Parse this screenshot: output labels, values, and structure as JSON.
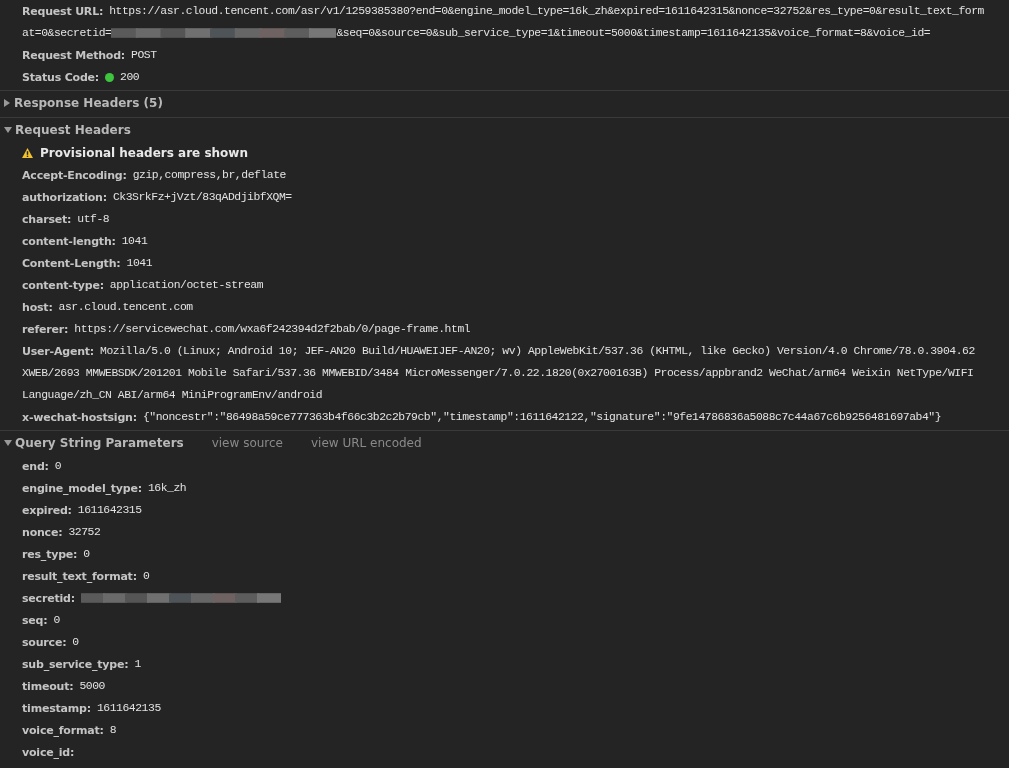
{
  "general": [
    {
      "label": "Request URL:",
      "kind": "text",
      "lines": [
        [
          {
            "kind": "text",
            "text": "https://asr.cloud.tencent.com/asr/v1/1259385380?end=0&engine_model_type=16k_zh&expired=1611642315&nonce=32752&res_type=0&result_text_form"
          }
        ],
        [
          {
            "kind": "text",
            "text": "at=0&secretid="
          },
          {
            "kind": "redacted"
          },
          {
            "kind": "text",
            "text": "&seq=0&source=0&sub_service_type=1&timeout=5000&timestamp=1611642135&voice_format=8&voice_id="
          }
        ]
      ]
    },
    {
      "label": "Request Method:",
      "kind": "text",
      "lines": [
        [
          {
            "kind": "text",
            "text": "POST"
          }
        ]
      ]
    },
    {
      "label": "Status Code:",
      "kind": "status",
      "lines": [
        [
          {
            "kind": "text",
            "text": "200"
          }
        ]
      ]
    }
  ],
  "sections": [
    {
      "title": "Response Headers (5)",
      "expanded": false
    },
    {
      "title": "Request Headers",
      "expanded": true,
      "warning": "Provisional headers are shown",
      "rows": [
        {
          "label": "Accept-Encoding:",
          "lines": [
            [
              {
                "kind": "text",
                "text": "gzip,compress,br,deflate"
              }
            ]
          ]
        },
        {
          "label": "authorization:",
          "lines": [
            [
              {
                "kind": "text",
                "text": "Ck3SrkFz+jVzt/83qADdjibfXQM="
              }
            ]
          ]
        },
        {
          "label": "charset:",
          "lines": [
            [
              {
                "kind": "text",
                "text": "utf-8"
              }
            ]
          ]
        },
        {
          "label": "content-length:",
          "lines": [
            [
              {
                "kind": "text",
                "text": "1041"
              }
            ]
          ]
        },
        {
          "label": "Content-Length:",
          "lines": [
            [
              {
                "kind": "text",
                "text": "1041"
              }
            ]
          ]
        },
        {
          "label": "content-type:",
          "lines": [
            [
              {
                "kind": "text",
                "text": "application/octet-stream"
              }
            ]
          ]
        },
        {
          "label": "host:",
          "lines": [
            [
              {
                "kind": "text",
                "text": "asr.cloud.tencent.com"
              }
            ]
          ]
        },
        {
          "label": "referer:",
          "lines": [
            [
              {
                "kind": "text",
                "text": "https://servicewechat.com/wxa6f242394d2f2bab/0/page-frame.html"
              }
            ]
          ]
        },
        {
          "label": "User-Agent:",
          "lines": [
            [
              {
                "kind": "text",
                "text": "Mozilla/5.0 (Linux; Android 10; JEF-AN20 Build/HUAWEIJEF-AN20; wv) AppleWebKit/537.36 (KHTML, like Gecko) Version/4.0 Chrome/78.0.3904.62"
              }
            ],
            [
              {
                "kind": "text",
                "text": "XWEB/2693 MMWEBSDK/201201 Mobile Safari/537.36 MMWEBID/3484 MicroMessenger/7.0.22.1820(0x2700163B) Process/appbrand2 WeChat/arm64 Weixin NetType/WIFI"
              }
            ],
            [
              {
                "kind": "text",
                "text": "Language/zh_CN ABI/arm64 MiniProgramEnv/android"
              }
            ]
          ]
        },
        {
          "label": "x-wechat-hostsign:",
          "lines": [
            [
              {
                "kind": "text",
                "text": "{\"noncestr\":\"86498a59ce777363b4f66c3b2c2b79cb\",\"timestamp\":1611642122,\"signature\":\"9fe14786836a5088c7c44a67c6b9256481697ab4\"}"
              }
            ]
          ]
        }
      ]
    },
    {
      "title": "Query String Parameters",
      "expanded": true,
      "links": [
        "view source",
        "view URL encoded"
      ],
      "rows": [
        {
          "label": "end:",
          "lines": [
            [
              {
                "kind": "text",
                "text": "0"
              }
            ]
          ]
        },
        {
          "label": "engine_model_type:",
          "lines": [
            [
              {
                "kind": "text",
                "text": "16k_zh"
              }
            ]
          ]
        },
        {
          "label": "expired:",
          "lines": [
            [
              {
                "kind": "text",
                "text": "1611642315"
              }
            ]
          ]
        },
        {
          "label": "nonce:",
          "lines": [
            [
              {
                "kind": "text",
                "text": "32752"
              }
            ]
          ]
        },
        {
          "label": "res_type:",
          "lines": [
            [
              {
                "kind": "text",
                "text": "0"
              }
            ]
          ]
        },
        {
          "label": "result_text_format:",
          "lines": [
            [
              {
                "kind": "text",
                "text": "0"
              }
            ]
          ]
        },
        {
          "label": "secretid:",
          "lines": [
            [
              {
                "kind": "redacted"
              }
            ]
          ]
        },
        {
          "label": "seq:",
          "lines": [
            [
              {
                "kind": "text",
                "text": "0"
              }
            ]
          ]
        },
        {
          "label": "source:",
          "lines": [
            [
              {
                "kind": "text",
                "text": "0"
              }
            ]
          ]
        },
        {
          "label": "sub_service_type:",
          "lines": [
            [
              {
                "kind": "text",
                "text": "1"
              }
            ]
          ]
        },
        {
          "label": "timeout:",
          "lines": [
            [
              {
                "kind": "text",
                "text": "5000"
              }
            ]
          ]
        },
        {
          "label": "timestamp:",
          "lines": [
            [
              {
                "kind": "text",
                "text": "1611642135"
              }
            ]
          ]
        },
        {
          "label": "voice_format:",
          "lines": [
            [
              {
                "kind": "text",
                "text": "8"
              }
            ]
          ]
        },
        {
          "label": "voice_id:"
        }
      ]
    }
  ]
}
